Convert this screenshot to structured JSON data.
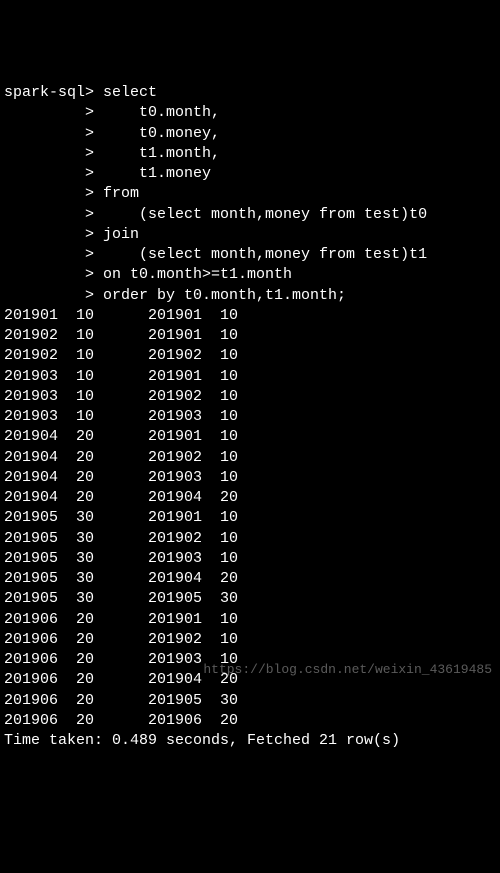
{
  "prompt": "spark-sql>",
  "cont_prompt": "         >",
  "query_lines": [
    " select",
    "     t0.month,",
    "     t0.money,",
    "     t1.month,",
    "     t1.money",
    " from",
    "     (select month,money from test)t0",
    " join",
    "     (select month,money from test)t1",
    " on t0.month>=t1.month",
    " order by t0.month,t1.month;"
  ],
  "results": [
    {
      "t0_month": "201901",
      "t0_money": "10",
      "t1_month": "201901",
      "t1_money": "10"
    },
    {
      "t0_month": "201902",
      "t0_money": "10",
      "t1_month": "201901",
      "t1_money": "10"
    },
    {
      "t0_month": "201902",
      "t0_money": "10",
      "t1_month": "201902",
      "t1_money": "10"
    },
    {
      "t0_month": "201903",
      "t0_money": "10",
      "t1_month": "201901",
      "t1_money": "10"
    },
    {
      "t0_month": "201903",
      "t0_money": "10",
      "t1_month": "201902",
      "t1_money": "10"
    },
    {
      "t0_month": "201903",
      "t0_money": "10",
      "t1_month": "201903",
      "t1_money": "10"
    },
    {
      "t0_month": "201904",
      "t0_money": "20",
      "t1_month": "201901",
      "t1_money": "10"
    },
    {
      "t0_month": "201904",
      "t0_money": "20",
      "t1_month": "201902",
      "t1_money": "10"
    },
    {
      "t0_month": "201904",
      "t0_money": "20",
      "t1_month": "201903",
      "t1_money": "10"
    },
    {
      "t0_month": "201904",
      "t0_money": "20",
      "t1_month": "201904",
      "t1_money": "20"
    },
    {
      "t0_month": "201905",
      "t0_money": "30",
      "t1_month": "201901",
      "t1_money": "10"
    },
    {
      "t0_month": "201905",
      "t0_money": "30",
      "t1_month": "201902",
      "t1_money": "10"
    },
    {
      "t0_month": "201905",
      "t0_money": "30",
      "t1_month": "201903",
      "t1_money": "10"
    },
    {
      "t0_month": "201905",
      "t0_money": "30",
      "t1_month": "201904",
      "t1_money": "20"
    },
    {
      "t0_month": "201905",
      "t0_money": "30",
      "t1_month": "201905",
      "t1_money": "30"
    },
    {
      "t0_month": "201906",
      "t0_money": "20",
      "t1_month": "201901",
      "t1_money": "10"
    },
    {
      "t0_month": "201906",
      "t0_money": "20",
      "t1_month": "201902",
      "t1_money": "10"
    },
    {
      "t0_month": "201906",
      "t0_money": "20",
      "t1_month": "201903",
      "t1_money": "10"
    },
    {
      "t0_month": "201906",
      "t0_money": "20",
      "t1_month": "201904",
      "t1_money": "20"
    },
    {
      "t0_month": "201906",
      "t0_money": "20",
      "t1_month": "201905",
      "t1_money": "30"
    },
    {
      "t0_month": "201906",
      "t0_money": "20",
      "t1_month": "201906",
      "t1_money": "20"
    }
  ],
  "footer": "Time taken: 0.489 seconds, Fetched 21 row(s)",
  "watermark": "https://blog.csdn.net/weixin_43619485"
}
